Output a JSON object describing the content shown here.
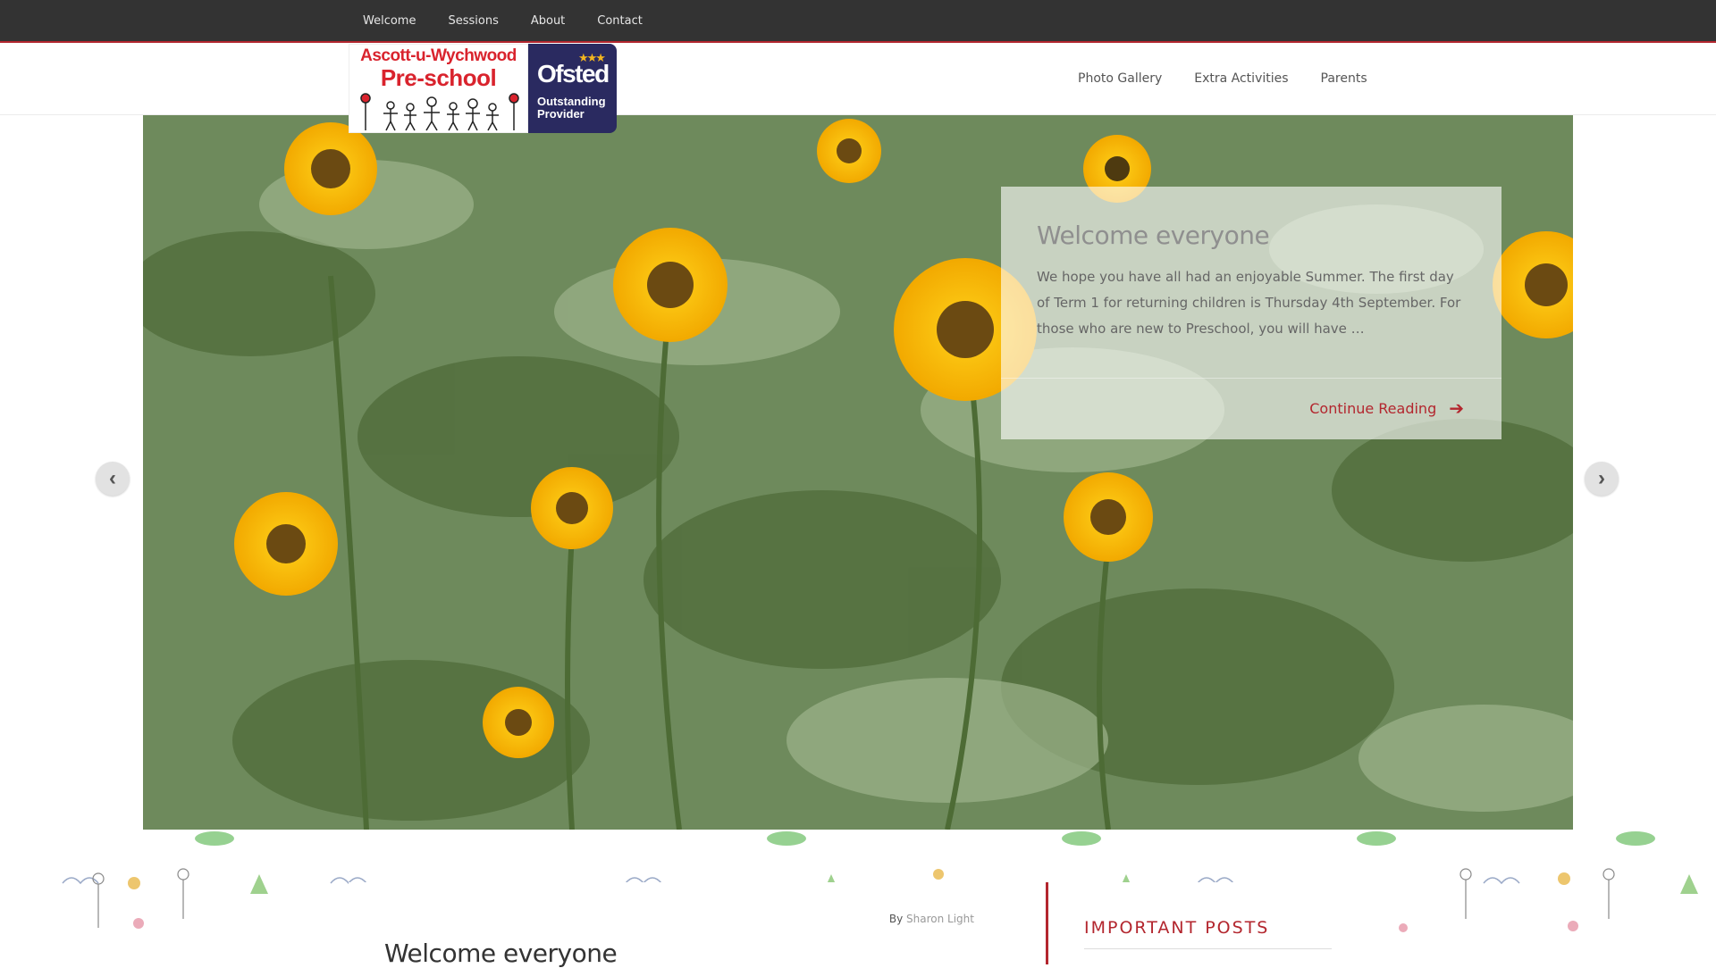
{
  "topnav": {
    "items": [
      {
        "label": "Welcome"
      },
      {
        "label": "Sessions"
      },
      {
        "label": "About"
      },
      {
        "label": "Contact"
      }
    ]
  },
  "logo": {
    "line1": "Ascott-u-Wychwood",
    "line2": "Pre-school",
    "ofsted_word": "Ofsted",
    "ofsted_stars": "★★★",
    "ofsted_sub1": "Outstanding",
    "ofsted_sub2": "Provider"
  },
  "mainnav": {
    "items": [
      {
        "label": "Photo Gallery"
      },
      {
        "label": "Extra Activities"
      },
      {
        "label": "Parents"
      }
    ]
  },
  "slider": {
    "title": "Welcome everyone",
    "excerpt": "We hope you have all had an enjoyable Summer. The first day of Term 1 for returning children is Thursday 4th September. For those who are new to Preschool, you will have …",
    "continue_label": "Continue Reading",
    "prev_icon": "chevron-left-icon",
    "next_icon": "chevron-right-icon"
  },
  "post": {
    "by_label": "By",
    "author": "Sharon Light",
    "title": "Welcome everyone"
  },
  "sidebar": {
    "title": "IMPORTANT POSTS"
  },
  "colors": {
    "accent": "#b3262e",
    "topbar": "#333333",
    "ofsted": "#2a2a60"
  }
}
